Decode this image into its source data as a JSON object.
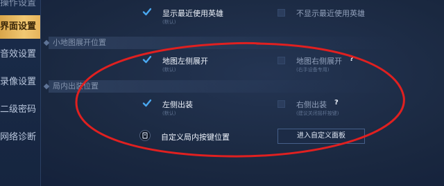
{
  "sidebar": {
    "items": [
      {
        "label": "操作设置",
        "state": "partial"
      },
      {
        "label": "界面设置",
        "state": "active"
      },
      {
        "label": "音效设置",
        "state": "normal"
      },
      {
        "label": "录像设置",
        "state": "normal"
      },
      {
        "label": "二级密码",
        "state": "normal"
      },
      {
        "label": "网络诊断",
        "state": "normal"
      }
    ]
  },
  "hero_section": {
    "show_recent": {
      "label": "显示最近使用英雄",
      "sub": "(默认)",
      "checked": true
    },
    "hide_recent": {
      "label": "不显示最近使用英雄",
      "checked": false
    }
  },
  "minimap_section": {
    "title": "小地图展开位置",
    "left": {
      "label": "地图左侧展开",
      "sub": "(默认)",
      "checked": true
    },
    "right": {
      "label": "地图右侧展开",
      "sub": "(右手设备专用)",
      "help": "?",
      "checked": false
    }
  },
  "equip_section": {
    "title": "局内出装位置",
    "left": {
      "label": "左侧出装",
      "sub": "(默认)",
      "checked": true
    },
    "right": {
      "label": "右侧出装",
      "sub": "(建议关闭摇杆按键)",
      "help": "?",
      "checked": false
    }
  },
  "custom_layout": {
    "label": "自定义局内按键位置",
    "icon": "gamepad-icon",
    "button_label": "进入自定义面板"
  },
  "colors": {
    "accent_gold": "#f1c873",
    "check_blue": "#4aa8f0",
    "annotation_red": "#e02020",
    "background": "#1b2a44"
  }
}
